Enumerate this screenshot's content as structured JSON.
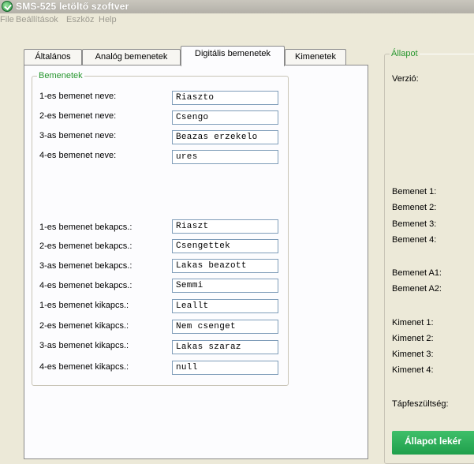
{
  "window": {
    "title": "SMS-525 letöltő szoftver"
  },
  "menu": [
    "File",
    "Beállítások",
    "Eszköz",
    "Help"
  ],
  "tabs": [
    "Általános",
    "Analóg bemenetek",
    "Digitális bemenetek",
    "Kimenetek"
  ],
  "active_tab": "Digitális bemenetek",
  "inputs_group": {
    "legend": "Bemenetek",
    "rows": [
      {
        "label": "1-es bemenet neve:",
        "value": "Riaszto"
      },
      {
        "label": "2-es bemenet neve:",
        "value": "Csengo"
      },
      {
        "label": "3-as bemenet neve:",
        "value": "Beazas erzekelo"
      },
      {
        "label": "4-es bemenet neve:",
        "value": "ures"
      },
      {
        "label": "1-es bemenet bekapcs.:",
        "value": "Riaszt"
      },
      {
        "label": "2-es bemenet bekapcs.:",
        "value": "Csengettek"
      },
      {
        "label": "3-as bemenet bekapcs.:",
        "value": "Lakas beazott"
      },
      {
        "label": "4-es bemenet bekapcs.:",
        "value": "Semmi"
      },
      {
        "label": "1-es bemenet kikapcs.:",
        "value": "Leallt"
      },
      {
        "label": "2-es bemenet kikapcs.:",
        "value": "Nem csenget"
      },
      {
        "label": "3-as bemenet kikapcs.:",
        "value": "Lakas szaraz"
      },
      {
        "label": "4-es bemenet kikapcs.:",
        "value": "null"
      }
    ]
  },
  "status": {
    "legend": "Állapot",
    "version_label": "Verzió:",
    "labels": [
      "Bemenet 1:",
      "Bemenet 2:",
      "Bemenet 3:",
      "Bemenet 4:",
      "Bemenet A1:",
      "Bemenet A2:",
      "Kimenet 1:",
      "Kimenet 2:",
      "Kimenet 3:",
      "Kimenet 4:",
      "Tápfeszültség:"
    ],
    "button_label": "Állapot lekér"
  },
  "colors": {
    "accent_green": "#26962e",
    "button_green": "#1f9f4c",
    "input_border": "#7f9db9"
  }
}
